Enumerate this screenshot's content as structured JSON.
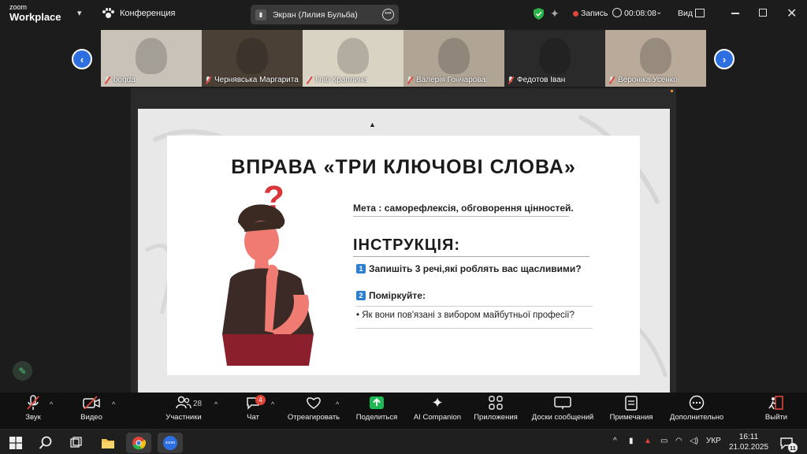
{
  "app": {
    "logo_line1": "zoom",
    "logo_line2": "Workplace",
    "meeting_name": "Конференция",
    "screen_share_label": "Экран (Лилия Бульба)",
    "recording_label": "Запись",
    "timer": "00:08:08",
    "view_label": "Вид"
  },
  "participants": [
    {
      "name": "bogda",
      "bg": "#c9c2b8"
    },
    {
      "name": "Чернявська Маргарита",
      "bg": "#4a4036"
    },
    {
      "name": "Гліб Краплина",
      "bg": "#d9d3c4"
    },
    {
      "name": "Валерія Гончарова",
      "bg": "#b0a494"
    },
    {
      "name": "Федотов Іван",
      "bg": "#2a2a2a"
    },
    {
      "name": "Вероніка Усенко",
      "bg": "#b9aa9a"
    }
  ],
  "slide": {
    "title": "ВПРАВА «ТРИ КЛЮЧОВІ СЛОВА»",
    "goal": "Мета : саморефлексія, обговорення цінностей.",
    "instructions_title": "ІНСТРУКЦІЯ:",
    "item1_num": "1",
    "item1": "Запишіть 3 речі,які роблять вас щасливими?",
    "item2_num": "2",
    "item2": "Поміркуйте:",
    "bullet": "• Як вони пов'язані з вибором майбутньої професії?"
  },
  "toolbar": {
    "audio": "Звук",
    "video": "Видео",
    "participants": "Участники",
    "participants_count": "28",
    "chat": "Чат",
    "chat_badge": "4",
    "react": "Отреагировать",
    "share": "Поделиться",
    "ai": "AI Companion",
    "apps": "Приложения",
    "whiteboards": "Доски сообщений",
    "notes": "Примечания",
    "more": "Дополнительно",
    "leave": "Выйти"
  },
  "taskbar": {
    "language": "УКР",
    "time": "16:11",
    "date": "21.02.2025",
    "notification_count": "11"
  },
  "colors": {
    "accent_blue": "#2d6ee0",
    "record_red": "#e0453a",
    "share_green": "#1db954"
  }
}
